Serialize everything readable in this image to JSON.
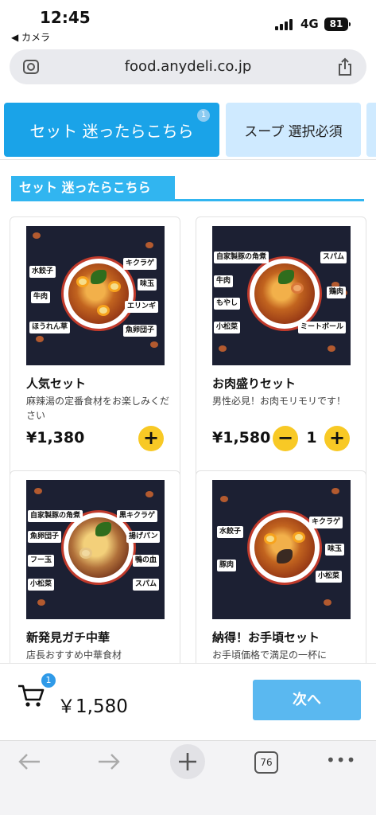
{
  "status_bar": {
    "time": "12:45",
    "back_app": "◀ カメラ",
    "network": "4G",
    "battery": "81"
  },
  "browser": {
    "url": "food.anydeli.co.jp",
    "tab_count": "76"
  },
  "category_tabs": [
    {
      "label": "セット 迷ったらこちら",
      "badge": "1",
      "active": true
    },
    {
      "label": "スープ 選択必須",
      "active": false
    }
  ],
  "section": {
    "title": "セット 迷ったらこちら"
  },
  "products": [
    {
      "name": "人気セット",
      "description": "麻辣湯の定番食材をお楽しみください",
      "price": "¥1,380",
      "tags": [
        "水餃子",
        "キクラゲ",
        "牛肉",
        "味玉",
        "エリンギ",
        "ほうれん草",
        "魚卵団子"
      ]
    },
    {
      "name": "お肉盛りセット",
      "description": "男性必見！お肉モリモリです！",
      "price": "¥1,580",
      "quantity": "1",
      "tags": [
        "自家製豚の角煮",
        "スパム",
        "牛肉",
        "鶏肉",
        "もやし",
        "小松菜",
        "ミートボール"
      ]
    },
    {
      "name": "新発見ガチ中華",
      "description": "店長おすすめ中華食材",
      "tags": [
        "自家製豚の角煮",
        "黒キクラゲ",
        "魚卵団子",
        "揚げパン",
        "フー玉",
        "鴨の血",
        "小松菜",
        "スパム"
      ]
    },
    {
      "name": "納得！お手頃セット",
      "description": "お手頃価格で満足の一杯に",
      "tags": [
        "水餃子",
        "キクラゲ",
        "味玉",
        "豚肉",
        "小松菜"
      ]
    }
  ],
  "cart": {
    "badge": "1",
    "total": "￥1,580",
    "next_label": "次へ"
  },
  "colors": {
    "accent": "#1aa3e8",
    "add_button": "#f8c925",
    "next_button": "#5ab8f0"
  },
  "icons": {
    "add": "+",
    "minus": "−",
    "more": "•••"
  }
}
